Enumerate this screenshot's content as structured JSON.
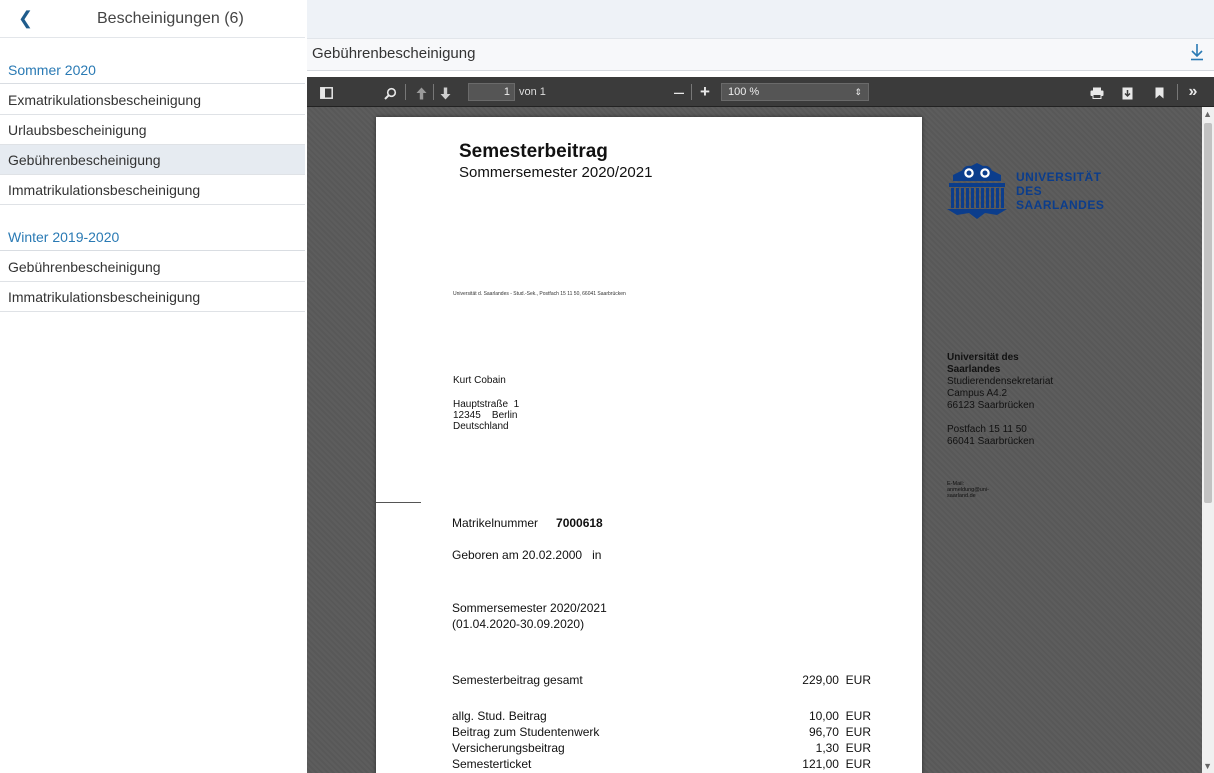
{
  "sidebar": {
    "back_icon": "chevron-left-icon",
    "title": "Bescheinigungen (6)",
    "sections": [
      {
        "label": "Sommer 2020",
        "items": [
          {
            "label": "Exmatrikulationsbescheinigung"
          },
          {
            "label": "Urlaubsbescheinigung"
          },
          {
            "label": "Gebührenbescheinigung",
            "active": true
          },
          {
            "label": "Immatrikulationsbescheinigung"
          }
        ]
      },
      {
        "label": "Winter 2019-2020",
        "items": [
          {
            "label": "Gebührenbescheinigung"
          },
          {
            "label": "Immatrikulationsbescheinigung"
          }
        ]
      }
    ]
  },
  "document_header": {
    "title": "Gebührenbescheinigung",
    "download_icon": "download-icon"
  },
  "pdf_toolbar": {
    "page_current": "1",
    "page_of": "von 1",
    "zoom": "100 %",
    "icons": [
      "sidebar-toggle-icon",
      "search-icon",
      "page-up-icon",
      "page-down-icon",
      "zoom-out-icon",
      "zoom-in-icon",
      "print-icon",
      "save-icon",
      "bookmark-icon",
      "more-tools-icon"
    ]
  },
  "document": {
    "title": "Semesterbeitrag",
    "subtitle": "Sommersemester 2020/2021",
    "logo_lines": [
      "UNIVERSITÄT",
      "DES",
      "SAARLANDES"
    ],
    "sender_line": "Universität d. Saarlandes - Stud.-Sek., Postfach 15 11 50, 66041 Saarbrücken",
    "recipient": {
      "name": "Kurt Cobain",
      "street": "Hauptstraße  1",
      "city": "12345    Berlin",
      "country": "Deutschland"
    },
    "university": {
      "name": "Universität des Saarlandes",
      "dept": "Studierendensekretariat",
      "campus": "Campus A4.2",
      "zip_city": "66123 Saarbrücken",
      "postbox": "Postfach 15 11 50",
      "postbox_city": "66041 Saarbrücken",
      "email": "E-Mail: anmeldung@uni-saarland.de"
    },
    "matrikel_label": "Matrikelnummer",
    "matrikel_number": "7000618",
    "born_line": "Geboren am 20.02.2000   in",
    "semester_name": "Sommersemester 2020/2021",
    "semester_period": "(01.04.2020-30.09.2020)",
    "fees": [
      {
        "label": "Semesterbeitrag gesamt",
        "amount": "229,00  EUR",
        "gap_after": true
      },
      {
        "label": "allg. Stud. Beitrag",
        "amount": "10,00  EUR"
      },
      {
        "label": "Beitrag zum Studentenwerk",
        "amount": "96,70  EUR"
      },
      {
        "label": "Versicherungsbeitrag",
        "amount": "1,30  EUR"
      },
      {
        "label": "Semesterticket",
        "amount": "121,00  EUR"
      }
    ]
  },
  "colors": {
    "accent": "#2a7ab4",
    "toolbar_bg": "#3b3b3b",
    "viewer_bg": "#5a5a5a",
    "logo_blue": "#0b3d8c",
    "active_item_bg": "#e6ebf1"
  }
}
